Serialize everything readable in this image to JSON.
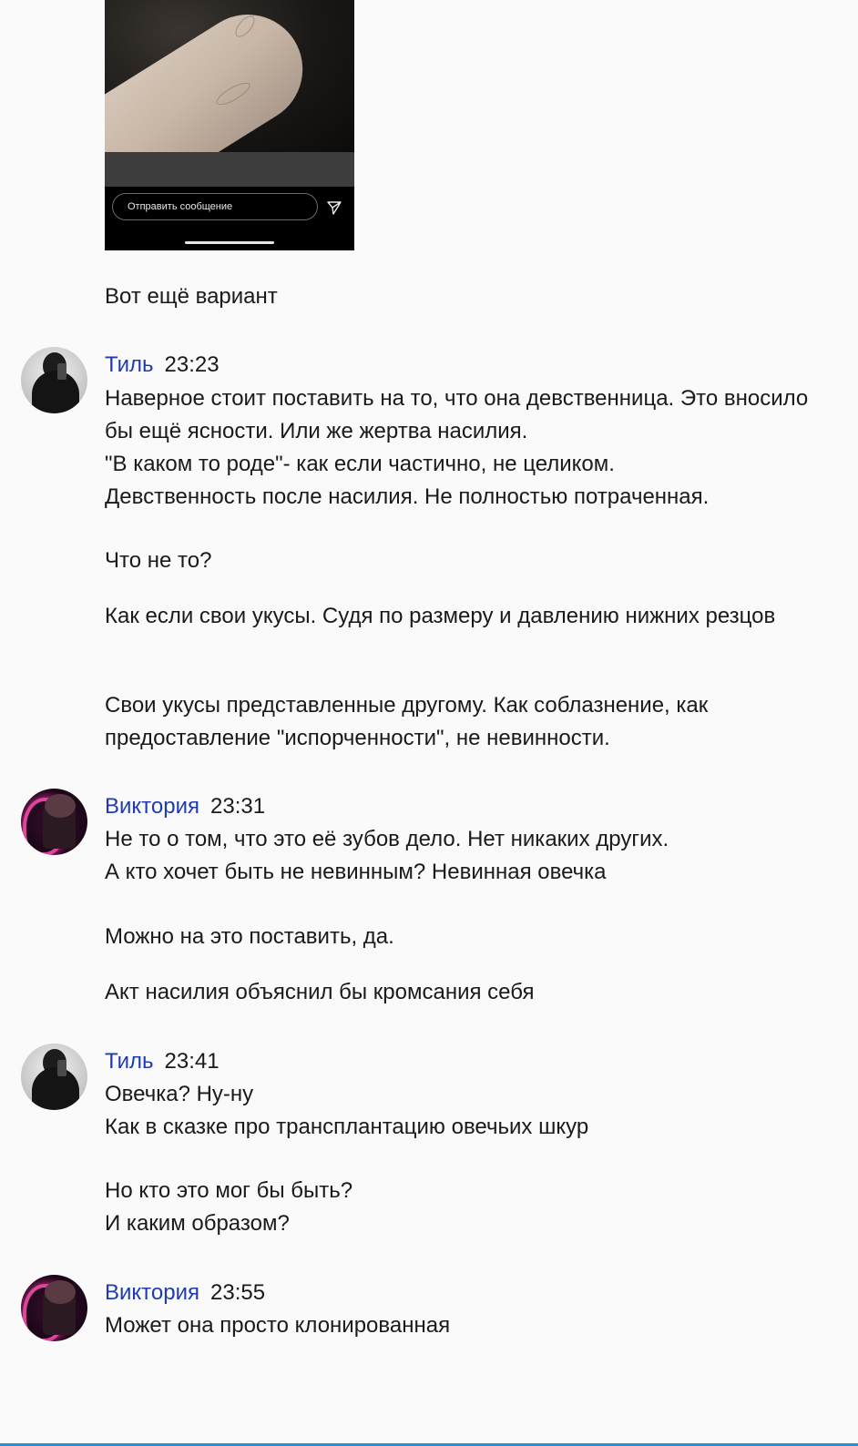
{
  "attachment": {
    "message_placeholder": "Отправить сообщение",
    "send_icon": "send-icon"
  },
  "intro_message": "Вот ещё вариант",
  "messages": [
    {
      "author": "Тиль",
      "time": "23:23",
      "avatar": "avatar-til",
      "paragraphs": [
        "Наверное стоит поставить на то, что она девственница. Это вносило бы ещё ясности. Или же жертва насилия.\n\"В каком то роде\"- как если частично, не целиком.\nДевственность после насилия. Не полностью потраченная.",
        "Что не то?",
        "Как если свои укусы. Судя по размеру и давлению нижних резцов",
        "Свои укусы представленные другому. Как соблазнение, как предоставление \"испорченности\", не невинности."
      ]
    },
    {
      "author": "Виктория",
      "time": "23:31",
      "avatar": "avatar-victoria",
      "paragraphs": [
        "Не то о том, что это её зубов дело. Нет никаких других.\nА кто хочет быть не невинным? Невинная овечка",
        "Можно на это поставить, да.",
        "Акт насилия объяснил бы кромсания себя"
      ]
    },
    {
      "author": "Тиль",
      "time": "23:41",
      "avatar": "avatar-til",
      "paragraphs": [
        "Овечка? Ну-ну\nКак в сказке про трансплантацию овечьих шкур",
        "Но кто это мог бы быть?\nИ каким образом?"
      ]
    },
    {
      "author": "Виктория",
      "time": "23:55",
      "avatar": "avatar-victoria",
      "paragraphs": [
        "Может она просто клонированная"
      ]
    }
  ]
}
